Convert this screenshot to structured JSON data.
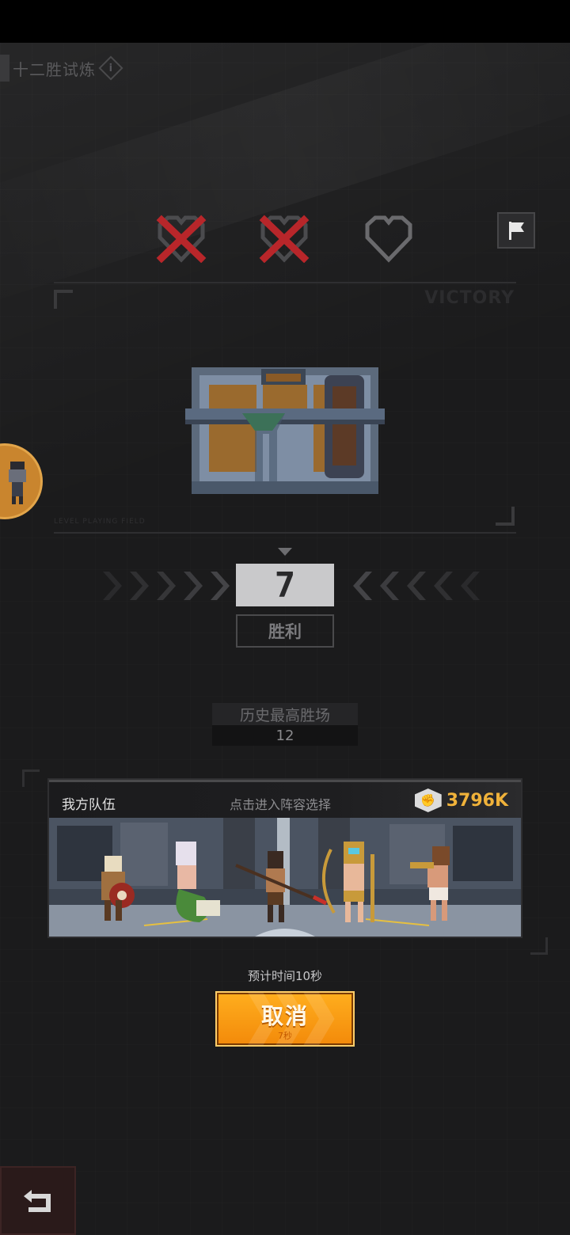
{
  "header": {
    "title": "十二胜试炼"
  },
  "lives": {
    "total": 3,
    "lost": 2,
    "icons": [
      "heart-lost-icon",
      "heart-lost-icon",
      "heart-empty-icon"
    ]
  },
  "panel": {
    "watermark_top": "VICTORY",
    "watermark_bottom": "LEVEL PLAYING FIELD",
    "reward": "treasure-chest"
  },
  "wins": {
    "count": "7",
    "label": "胜利"
  },
  "best": {
    "label": "历史最高胜场",
    "value": "12"
  },
  "team": {
    "title": "我方队伍",
    "hint": "点击进入阵容选择",
    "power": "3796K",
    "power_icon": "fist-icon",
    "members": [
      "shield-warrior",
      "naga-sorceress",
      "spear-fighter",
      "golden-archer",
      "gunner-girl"
    ]
  },
  "matchmaking": {
    "eta": "预计时间10秒",
    "cancel_label": "取消",
    "cancel_sub": "7秒"
  },
  "colors": {
    "accent": "#f0b23a",
    "button": "#f7961a",
    "lost": "#b8262a"
  }
}
